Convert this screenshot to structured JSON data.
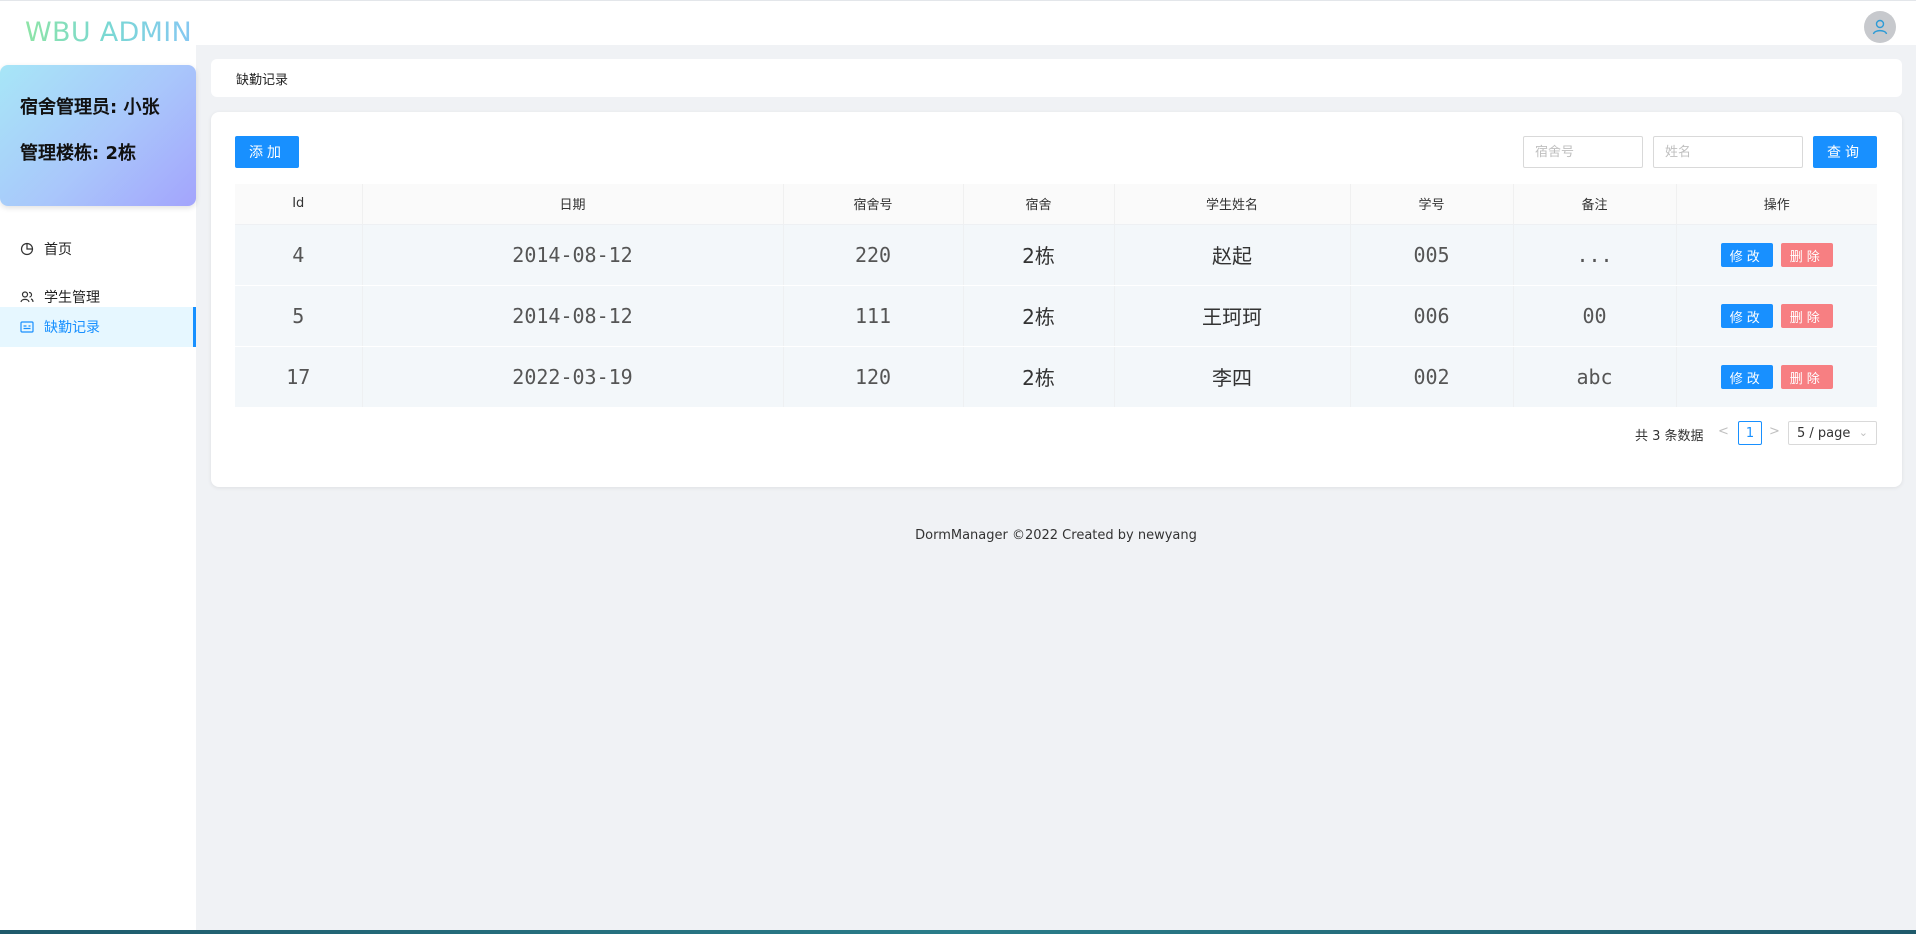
{
  "app": {
    "logo": "WBU ADMIN"
  },
  "profile": {
    "manager_line": "宿舍管理员: 小张",
    "building_line": "管理楼栋: 2栋"
  },
  "sidebar": {
    "items": [
      {
        "label": "首页",
        "icon": "pie-chart-icon",
        "active": false
      },
      {
        "label": "学生管理",
        "icon": "users-icon",
        "active": false
      },
      {
        "label": "缺勤记录",
        "icon": "calendar-icon",
        "active": true
      }
    ]
  },
  "breadcrumb": "缺勤记录",
  "toolbar": {
    "add_label": "添加",
    "dorm_placeholder": "宿舍号",
    "name_placeholder": "姓名",
    "query_label": "查询"
  },
  "table": {
    "columns": [
      "Id",
      "日期",
      "宿舍号",
      "宿舍",
      "学生姓名",
      "学号",
      "备注",
      "操作"
    ],
    "rows": [
      {
        "id": "4",
        "date": "2014-08-12",
        "room": "220",
        "building": "2栋",
        "name": "赵起",
        "student_no": "005",
        "note": "..."
      },
      {
        "id": "5",
        "date": "2014-08-12",
        "room": "111",
        "building": "2栋",
        "name": "王珂珂",
        "student_no": "006",
        "note": "00"
      },
      {
        "id": "17",
        "date": "2022-03-19",
        "room": "120",
        "building": "2栋",
        "name": "李四",
        "student_no": "002",
        "note": "abc"
      }
    ],
    "edit_label": "修改",
    "delete_label": "删除"
  },
  "pagination": {
    "total_text": "共 3 条数据",
    "current_page": "1",
    "page_size": "5 / page"
  },
  "footer": "DormManager ©2022 Created by newyang",
  "colors": {
    "primary": "#1890ff",
    "danger": "#f77f82",
    "background": "#f0f2f5"
  }
}
